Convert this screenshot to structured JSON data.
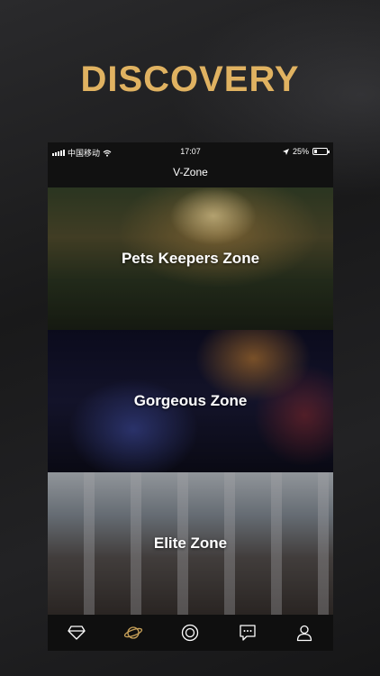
{
  "hero": {
    "title": "DISCOVERY"
  },
  "status_bar": {
    "carrier": "中国移动",
    "time": "17:07",
    "battery": "25%",
    "battery_level": 0.25
  },
  "nav": {
    "title": "V-Zone"
  },
  "zones": [
    {
      "label": "Pets Keepers Zone"
    },
    {
      "label": "Gorgeous Zone"
    },
    {
      "label": "Elite Zone"
    }
  ],
  "tab_bar": {
    "items": [
      {
        "icon": "diamond-icon",
        "active": false
      },
      {
        "icon": "planet-icon",
        "active": true
      },
      {
        "icon": "target-icon",
        "active": false
      },
      {
        "icon": "chat-icon",
        "active": false
      },
      {
        "icon": "profile-icon",
        "active": false
      }
    ]
  },
  "colors": {
    "accent": "#e0b261",
    "active_tab": "#c9a25a",
    "inactive_tab": "#ffffff"
  }
}
